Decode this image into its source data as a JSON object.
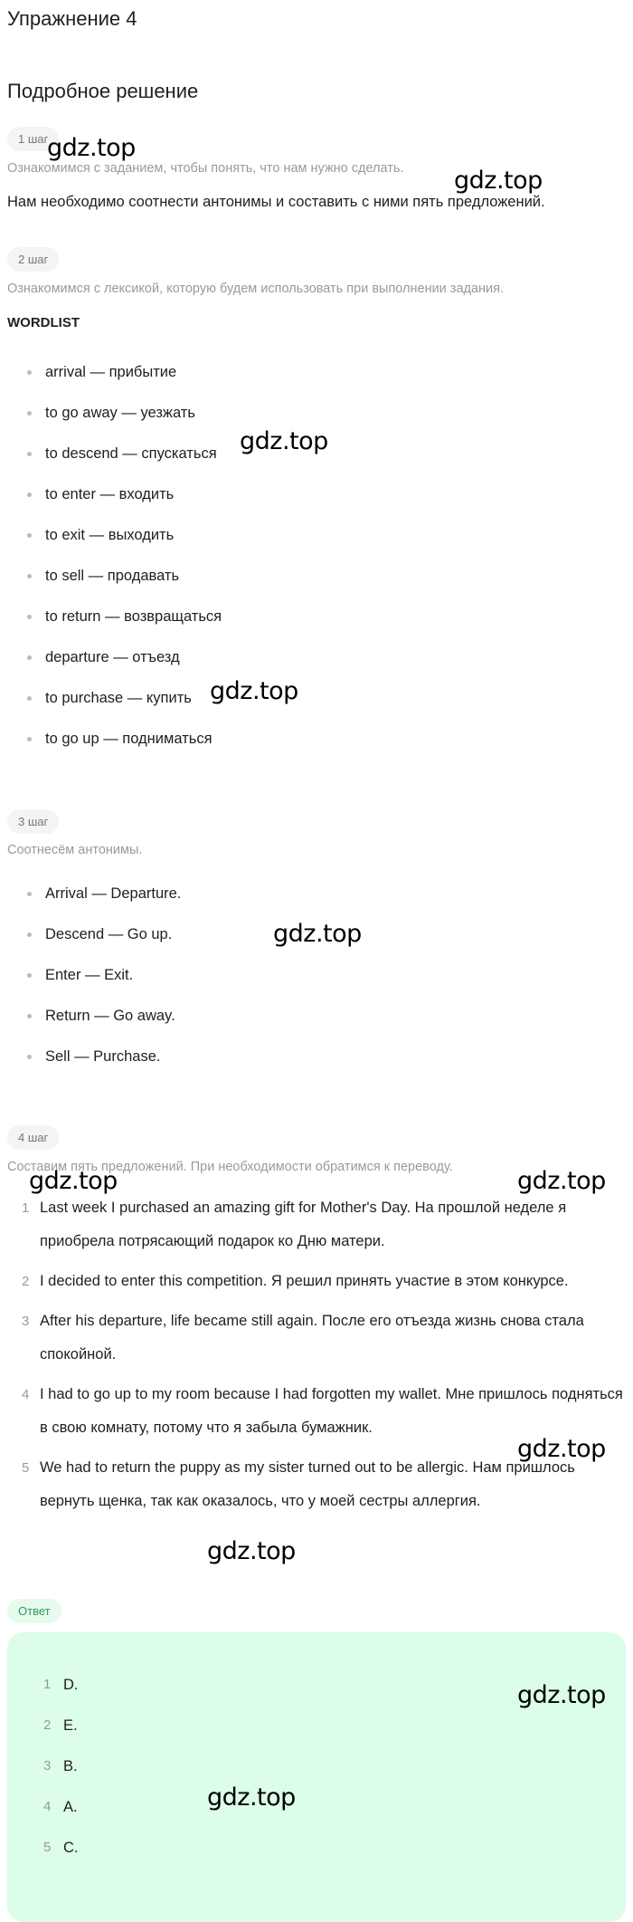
{
  "title": "Упражнение 4",
  "solution_heading": "Подробное решение",
  "steps": [
    {
      "badge": "1 шаг",
      "hint": "Ознакомимся с заданием, чтобы понять, что нам нужно сделать.",
      "text": "Нам необходимо соотнести антонимы и составить с ними пять предложений."
    },
    {
      "badge": "2 шаг",
      "hint": "Ознакомимся с лексикой, которую будем использовать при выполнении задания.",
      "heading": "WORDLIST",
      "items": [
        "arrival — прибытие",
        "to go away — уезжать",
        "to descend — спускаться",
        "to enter — входить",
        "to exit — выходить",
        "to sell — продавать",
        "to return — возвращаться",
        "departure — отъезд",
        "to purchase — купить",
        "to go up — подниматься"
      ]
    },
    {
      "badge": "3 шаг",
      "hint": "Соотнесём антонимы.",
      "items": [
        "Arrival — Departure.",
        "Descend — Go up.",
        "Enter — Exit.",
        "Return — Go away.",
        "Sell — Purchase."
      ]
    },
    {
      "badge": "4 шаг",
      "hint": "Составим пять предложений. При необходимости обратимся к переводу.",
      "items": [
        {
          "n": "1",
          "text": "Last week I purchased an amazing gift for Mother's Day. На прошлой неделе я приобрела потрясающий подарок ко Дню матери."
        },
        {
          "n": "2",
          "text": "I decided to enter this competition. Я решил принять участие в этом конкурсе."
        },
        {
          "n": "3",
          "text": "After his departure, life became still again. После его отъезда жизнь снова стала спокойной."
        },
        {
          "n": "4",
          "text": "I had to go up to my room because I had forgotten my wallet. Мне пришлось подняться в свою комнату, потому что я забыла бумажник."
        },
        {
          "n": "5",
          "text": "We had to return the puppy as my sister turned out to be allergic. Нам пришлось вернуть щенка, так как оказалось, что у моей сестры аллергия."
        }
      ]
    }
  ],
  "answer": {
    "badge": "Ответ",
    "items": [
      {
        "n": "1",
        "text": "D."
      },
      {
        "n": "2",
        "text": "E."
      },
      {
        "n": "3",
        "text": "B."
      },
      {
        "n": "4",
        "text": "A."
      },
      {
        "n": "5",
        "text": "C."
      }
    ]
  },
  "watermark": "gdz.top",
  "colors": {
    "answer_bg": "#dcfde7",
    "answer_badge_text": "#2f9a5a",
    "hint_text": "#9a9a9a"
  }
}
